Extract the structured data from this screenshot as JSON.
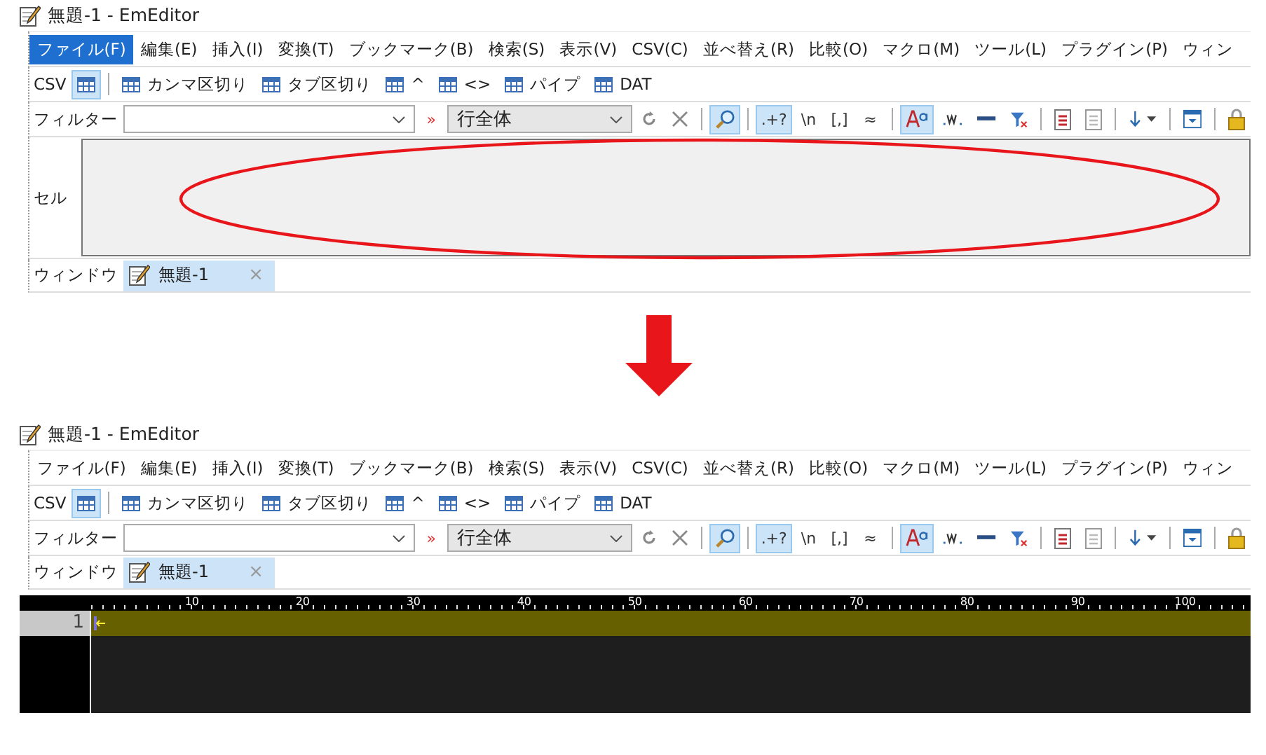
{
  "panels": [
    {
      "title": "無題-1 - EmEditor",
      "menu": [
        {
          "label": "ファイル(F)",
          "selected": true
        },
        {
          "label": "編集(E)",
          "selected": false
        },
        {
          "label": "挿入(I)",
          "selected": false
        },
        {
          "label": "変換(T)",
          "selected": false
        },
        {
          "label": "ブックマーク(B)",
          "selected": false
        },
        {
          "label": "検索(S)",
          "selected": false
        },
        {
          "label": "表示(V)",
          "selected": false
        },
        {
          "label": "CSV(C)",
          "selected": false
        },
        {
          "label": "並べ替え(R)",
          "selected": false
        },
        {
          "label": "比較(O)",
          "selected": false
        },
        {
          "label": "マクロ(M)",
          "selected": false
        },
        {
          "label": "ツール(L)",
          "selected": false
        },
        {
          "label": "プラグイン(P)",
          "selected": false
        },
        {
          "label": "ウィン",
          "selected": false
        }
      ],
      "csv_bar": {
        "label": "CSV",
        "grid_toggle_on": true,
        "formats": [
          "カンマ区切り",
          "タブ区切り",
          "^",
          "<>",
          "パイプ",
          "DAT"
        ]
      },
      "filter_bar": {
        "label": "フィルター",
        "marker": "»",
        "scope": "行全体",
        "groups": [
          [
            {
              "kind": "refresh",
              "pressed": false
            },
            {
              "kind": "clear",
              "pressed": false
            }
          ],
          [
            {
              "kind": "search",
              "pressed": true
            }
          ],
          [
            {
              "kind": "text",
              "text": ".+?",
              "pressed": true
            },
            {
              "kind": "text",
              "text": "\\n",
              "pressed": false
            },
            {
              "kind": "text",
              "text": "[,]",
              "pressed": false
            },
            {
              "kind": "text",
              "text": "≈",
              "pressed": false
            }
          ],
          [
            {
              "kind": "match-case",
              "pressed": true
            },
            {
              "kind": "word",
              "pressed": false
            },
            {
              "kind": "line",
              "pressed": false
            },
            {
              "kind": "filter-clear",
              "pressed": false
            }
          ],
          [
            {
              "kind": "doc-lines",
              "pressed": false
            },
            {
              "kind": "doc",
              "pressed": false
            }
          ],
          [
            {
              "kind": "arrow-down",
              "pressed": false
            }
          ],
          [
            {
              "kind": "window",
              "pressed": false
            }
          ],
          [
            {
              "kind": "lock",
              "pressed": false
            }
          ]
        ]
      },
      "cell_bar": {
        "label": "セル",
        "circled": true
      },
      "window_bar": {
        "label": "ウィンドウ",
        "tabs": [
          {
            "label": "無題-1",
            "close": "×",
            "selected": true
          }
        ]
      }
    },
    {
      "title": "無題-1 - EmEditor",
      "menu": [
        {
          "label": "ファイル(F)",
          "selected": false
        },
        {
          "label": "編集(E)",
          "selected": false
        },
        {
          "label": "挿入(I)",
          "selected": false
        },
        {
          "label": "変換(T)",
          "selected": false
        },
        {
          "label": "ブックマーク(B)",
          "selected": false
        },
        {
          "label": "検索(S)",
          "selected": false
        },
        {
          "label": "表示(V)",
          "selected": false
        },
        {
          "label": "CSV(C)",
          "selected": false
        },
        {
          "label": "並べ替え(R)",
          "selected": false
        },
        {
          "label": "比較(O)",
          "selected": false
        },
        {
          "label": "マクロ(M)",
          "selected": false
        },
        {
          "label": "ツール(L)",
          "selected": false
        },
        {
          "label": "プラグイン(P)",
          "selected": false
        },
        {
          "label": "ウィン",
          "selected": false
        }
      ],
      "csv_bar": {
        "label": "CSV",
        "grid_toggle_on": true,
        "formats": [
          "カンマ区切り",
          "タブ区切り",
          "^",
          "<>",
          "パイプ",
          "DAT"
        ]
      },
      "filter_bar": {
        "label": "フィルター",
        "marker": "»",
        "scope": "行全体",
        "groups": [
          [
            {
              "kind": "refresh",
              "pressed": false
            },
            {
              "kind": "clear",
              "pressed": false
            }
          ],
          [
            {
              "kind": "search",
              "pressed": true
            }
          ],
          [
            {
              "kind": "text",
              "text": ".+?",
              "pressed": true
            },
            {
              "kind": "text",
              "text": "\\n",
              "pressed": false
            },
            {
              "kind": "text",
              "text": "[,]",
              "pressed": false
            },
            {
              "kind": "text",
              "text": "≈",
              "pressed": false
            }
          ],
          [
            {
              "kind": "match-case",
              "pressed": true
            },
            {
              "kind": "word",
              "pressed": false
            },
            {
              "kind": "line",
              "pressed": false
            },
            {
              "kind": "filter-clear",
              "pressed": false
            }
          ],
          [
            {
              "kind": "doc-lines",
              "pressed": false
            },
            {
              "kind": "doc",
              "pressed": false
            }
          ],
          [
            {
              "kind": "arrow-down",
              "pressed": false
            }
          ],
          [
            {
              "kind": "window",
              "pressed": false
            }
          ],
          [
            {
              "kind": "lock",
              "pressed": false
            }
          ]
        ]
      },
      "window_bar": {
        "label": "ウィンドウ",
        "tabs": [
          {
            "label": "無題-1",
            "close": "×",
            "selected": true
          }
        ]
      },
      "editor": {
        "ruler": [
          "10",
          "20",
          "30",
          "40",
          "50",
          "60",
          "70",
          "80",
          "90",
          "100"
        ],
        "line_numbers": [
          "1"
        ]
      }
    }
  ]
}
